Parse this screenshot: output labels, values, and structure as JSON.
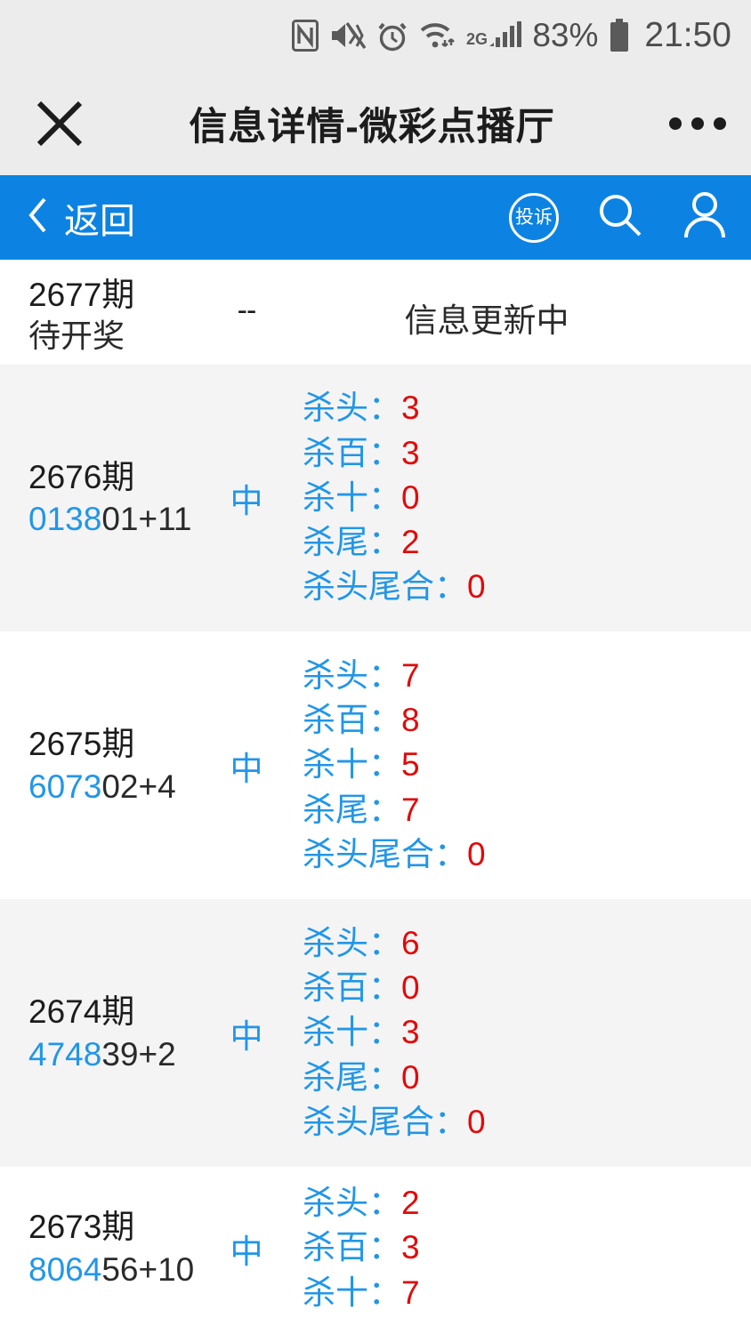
{
  "statusbar": {
    "icons": [
      "nfc-icon",
      "mute-vibrate-icon",
      "alarm-icon",
      "wifi-icon",
      "signal-2g-icon"
    ],
    "network_label": "2G",
    "battery_percent": "83%",
    "clock": "21:50"
  },
  "header": {
    "close_icon": "close-icon",
    "title": "信息详情-微彩点播厅",
    "more_icon": "more-dots-icon"
  },
  "navbar": {
    "back_label": "返回",
    "back_icon": "chevron-left-icon",
    "complaint_label": "投诉",
    "search_icon": "search-icon",
    "user_icon": "user-icon",
    "accent_color": "#0c83e2"
  },
  "colors": {
    "label_blue": "#2196e8",
    "value_red": "#e00a0a",
    "row_white": "#ffffff",
    "row_gray": "#f4f4f4",
    "status_bg": "#ececec"
  },
  "labels": {
    "kill_head": "杀头",
    "kill_hundred": "杀百",
    "kill_ten": "杀十",
    "kill_tail": "杀尾",
    "kill_headtail_sum": "杀头尾合",
    "colon": "：",
    "hit": "中",
    "dash": "--"
  },
  "rows": [
    {
      "issue": "2677期",
      "status": "待开奖",
      "numbers_blue": "",
      "numbers_rest": "",
      "hit": "--",
      "message": "信息更新中",
      "stats": []
    },
    {
      "issue": "2676期",
      "status": "",
      "numbers_blue": "0138",
      "numbers_rest": "01+11",
      "hit": "中",
      "message": "",
      "stats": [
        {
          "label": "杀头",
          "value": "3"
        },
        {
          "label": "杀百",
          "value": "3"
        },
        {
          "label": "杀十",
          "value": "0"
        },
        {
          "label": "杀尾",
          "value": "2"
        },
        {
          "label": "杀头尾合",
          "value": "0"
        }
      ]
    },
    {
      "issue": "2675期",
      "status": "",
      "numbers_blue": "6073",
      "numbers_rest": "02+4",
      "hit": "中",
      "message": "",
      "stats": [
        {
          "label": "杀头",
          "value": "7"
        },
        {
          "label": "杀百",
          "value": "8"
        },
        {
          "label": "杀十",
          "value": "5"
        },
        {
          "label": "杀尾",
          "value": "7"
        },
        {
          "label": "杀头尾合",
          "value": "0"
        }
      ]
    },
    {
      "issue": "2674期",
      "status": "",
      "numbers_blue": "4748",
      "numbers_rest": "39+2",
      "hit": "中",
      "message": "",
      "stats": [
        {
          "label": "杀头",
          "value": "6"
        },
        {
          "label": "杀百",
          "value": "0"
        },
        {
          "label": "杀十",
          "value": "3"
        },
        {
          "label": "杀尾",
          "value": "0"
        },
        {
          "label": "杀头尾合",
          "value": "0"
        }
      ]
    },
    {
      "issue": "2673期",
      "status": "",
      "numbers_blue": "8064",
      "numbers_rest": "56+10",
      "hit": "中",
      "message": "",
      "stats": [
        {
          "label": "杀头",
          "value": "2"
        },
        {
          "label": "杀百",
          "value": "3"
        },
        {
          "label": "杀十",
          "value": "7"
        }
      ]
    }
  ]
}
